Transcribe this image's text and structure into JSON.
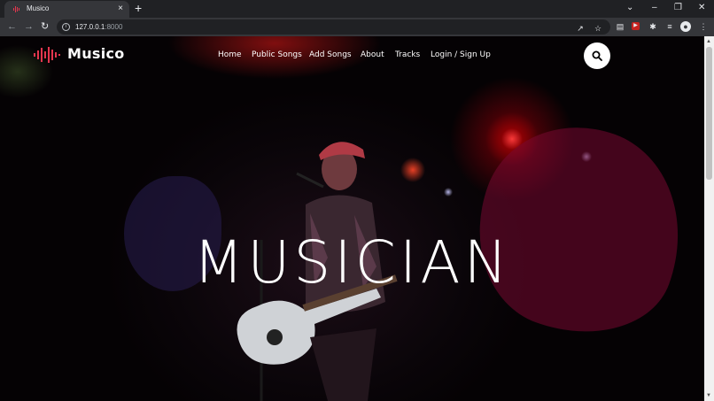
{
  "browser": {
    "tab_title": "Musico",
    "tab_close": "×",
    "new_tab": "+",
    "url_host": "127.0.0.1",
    "url_port": ":8000",
    "window_controls": {
      "chevron": "⌄",
      "minimize": "–",
      "restore": "❐",
      "close": "✕"
    }
  },
  "site": {
    "logo_text": "Musico",
    "nav": [
      "Home",
      "Public Songs",
      "Add Songs",
      "About",
      "Tracks",
      "Login / Sign Up"
    ],
    "hero_title": "MUSICIAN"
  },
  "colors": {
    "accent": "#e4364e",
    "header_text": "#ffffff",
    "search_bg": "#ffffff"
  },
  "icons": [
    "music-favicon-icon",
    "back-icon",
    "forward-icon",
    "reload-icon",
    "info-icon",
    "share-icon",
    "star-icon",
    "search-icon",
    "extensions-icon",
    "profile-icon",
    "menu-icon"
  ]
}
